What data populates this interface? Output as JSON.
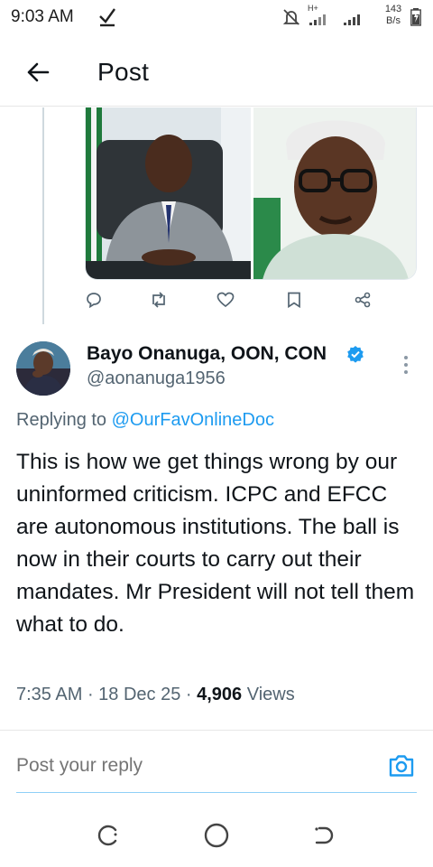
{
  "status_bar": {
    "time": "9:03 AM",
    "net_speed_value": "143",
    "net_speed_unit": "B/s",
    "network_label": "H+",
    "icons": [
      "check-icon",
      "mute-icon",
      "signal-icon",
      "battery-icon"
    ]
  },
  "header": {
    "title": "Post",
    "back_icon": "arrow-left-icon"
  },
  "parent_post": {
    "media": [
      "photo-man-in-suit-office",
      "photo-man-in-cap-glasses"
    ],
    "actions": [
      "reply-icon",
      "repost-icon",
      "like-icon",
      "bookmark-icon",
      "share-icon"
    ]
  },
  "post": {
    "author_name": "Bayo Onanuga, OON, CON",
    "author_handle": "@aonanuga1956",
    "verified": true,
    "replying_prefix": "Replying to",
    "replying_to": "@OurFavOnlineDoc",
    "text": "This is how we get things wrong by our uninformed criticism. ICPC and EFCC are autonomous institutions. The ball is now in their courts to carry out their mandates. Mr President will not tell them what to do.",
    "time": "7:35 AM",
    "date": "18 Dec 25",
    "views_count": "4,906",
    "views_label": "Views"
  },
  "reply": {
    "placeholder": "Post your reply",
    "camera_icon": "camera-icon"
  },
  "nav": {
    "items": [
      "recents-icon",
      "home-icon",
      "back-icon"
    ]
  },
  "colors": {
    "accent": "#1d9bf0",
    "text_primary": "#0f1419",
    "text_secondary": "#536471",
    "divider": "#e7e7e7"
  }
}
